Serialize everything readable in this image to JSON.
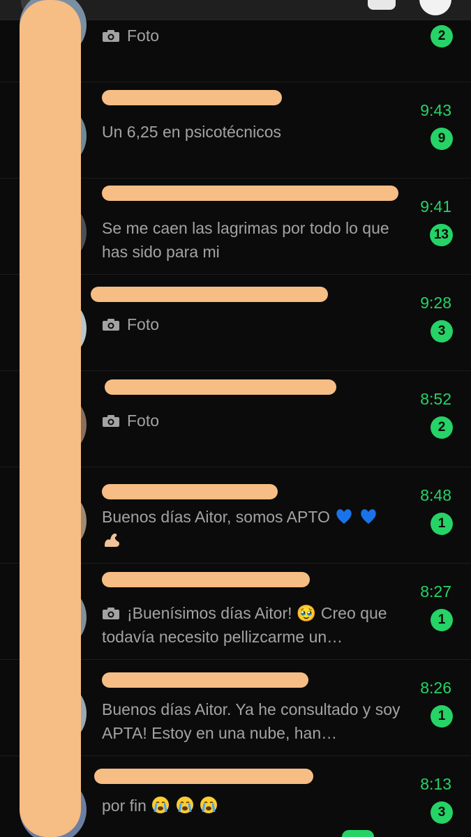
{
  "chats": [
    {
      "name": "",
      "preview": "Foto",
      "time": "",
      "badge": "2",
      "has_camera": true,
      "emojis": []
    },
    {
      "name": "",
      "preview": "Un 6,25 en psicotécnicos",
      "time": "9:43",
      "badge": "9",
      "has_camera": false,
      "emojis": []
    },
    {
      "name": "",
      "preview": "Se me caen las lagrimas por todo lo que has sido para mi",
      "time": "9:41",
      "badge": "13",
      "has_camera": false,
      "emojis": []
    },
    {
      "name": "",
      "preview": "Foto",
      "time": "9:28",
      "badge": "3",
      "has_camera": true,
      "emojis": []
    },
    {
      "name": "",
      "preview": "Foto",
      "time": "8:52",
      "badge": "2",
      "has_camera": true,
      "emojis": []
    },
    {
      "name": "",
      "preview": "Buenos días Aitor, somos APTO",
      "time": "8:48",
      "badge": "1",
      "has_camera": false,
      "emojis": [
        "blue-heart",
        "blue-heart",
        "flexed-biceps"
      ]
    },
    {
      "name": "",
      "preview": "¡Buenísimos días Aitor! 🥹 Creo que todavía necesito pellizcarme un…",
      "time": "8:27",
      "badge": "1",
      "has_camera": true,
      "emojis": []
    },
    {
      "name": "",
      "preview": "Buenos días Aitor. Ya he consultado y soy APTA!  Estoy en una nube, han…",
      "time": "8:26",
      "badge": "1",
      "has_camera": false,
      "emojis": []
    },
    {
      "name": "",
      "preview": "por fin",
      "time": "8:13",
      "badge": "3",
      "has_camera": false,
      "emojis": [
        "loudly-crying-face",
        "loudly-crying-face",
        "loudly-crying-face"
      ]
    }
  ],
  "colors": {
    "accent": "#25d366",
    "background": "#0b0b0b",
    "redaction": "#f6bd85"
  }
}
